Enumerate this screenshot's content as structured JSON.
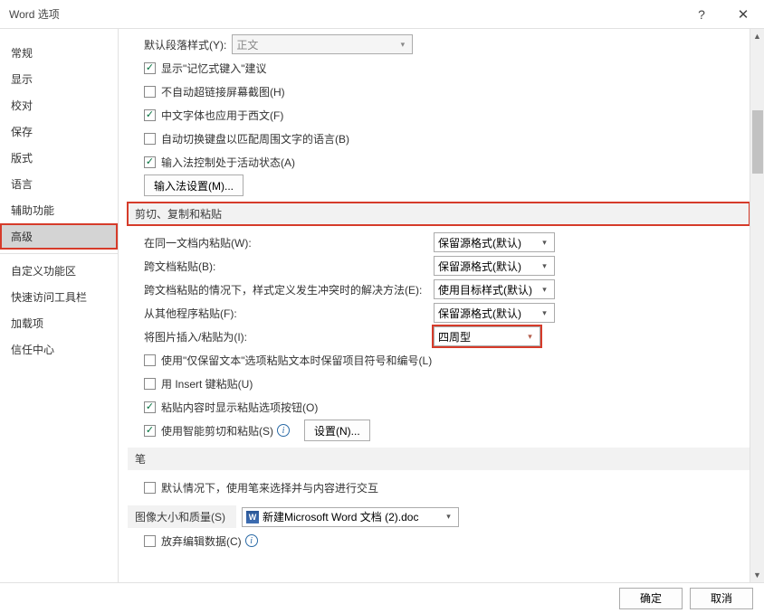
{
  "titlebar": {
    "title": "Word 选项",
    "help": "?",
    "close": "✕"
  },
  "sidebar": {
    "items": [
      {
        "label": "常规"
      },
      {
        "label": "显示"
      },
      {
        "label": "校对"
      },
      {
        "label": "保存"
      },
      {
        "label": "版式"
      },
      {
        "label": "语言"
      },
      {
        "label": "辅助功能"
      },
      {
        "label": "高级",
        "selected": true,
        "highlight": true
      }
    ],
    "items2": [
      {
        "label": "自定义功能区"
      },
      {
        "label": "快速访问工具栏"
      },
      {
        "label": "加载项"
      },
      {
        "label": "信任中心"
      }
    ]
  },
  "top": {
    "default_para_label": "默认段落样式(Y):",
    "default_para_value": "正文",
    "cb_memory": {
      "checked": true,
      "label": "显示\"记忆式键入\"建议"
    },
    "cb_nohyper": {
      "checked": false,
      "label": "不自动超链接屏幕截图(H)"
    },
    "cb_cjk_west": {
      "checked": true,
      "label": "中文字体也应用于西文(F)"
    },
    "cb_autokbd": {
      "checked": false,
      "label": "自动切换键盘以匹配周围文字的语言(B)"
    },
    "cb_ime_active": {
      "checked": true,
      "label": "输入法控制处于活动状态(A)"
    },
    "ime_btn": "输入法设置(M)..."
  },
  "sect_ccp": "剪切、复制和粘贴",
  "ccp": {
    "row1_label": "在同一文档内粘贴(W):",
    "row1_value": "保留源格式(默认)",
    "row2_label": "跨文档粘贴(B):",
    "row2_value": "保留源格式(默认)",
    "row3_label": "跨文档粘贴的情况下，样式定义发生冲突时的解决方法(E):",
    "row3_value": "使用目标样式(默认)",
    "row4_label": "从其他程序粘贴(F):",
    "row4_value": "保留源格式(默认)",
    "row5_label": "将图片插入/粘贴为(I):",
    "row5_value": "四周型",
    "cb_keeptext": {
      "checked": false,
      "label": "使用\"仅保留文本\"选项粘贴文本时保留项目符号和编号(L)"
    },
    "cb_insertkey": {
      "checked": false,
      "label": "用 Insert 键粘贴(U)"
    },
    "cb_showbtn": {
      "checked": true,
      "label": "粘贴内容时显示粘贴选项按钮(O)"
    },
    "cb_smart": {
      "checked": true,
      "label": "使用智能剪切和粘贴(S)"
    },
    "settings_btn": "设置(N)..."
  },
  "sect_pen": "笔",
  "pen": {
    "cb_default_pen": {
      "checked": false,
      "label": "默认情况下，使用笔来选择并与内容进行交互"
    }
  },
  "sect_img": "图像大小和质量(S)",
  "img": {
    "doc_value": "新建Microsoft Word 文档 (2).doc",
    "cb_discard": {
      "checked": false,
      "label": "放弃编辑数据(C)"
    }
  },
  "footer": {
    "ok": "确定",
    "cancel": "取消"
  }
}
